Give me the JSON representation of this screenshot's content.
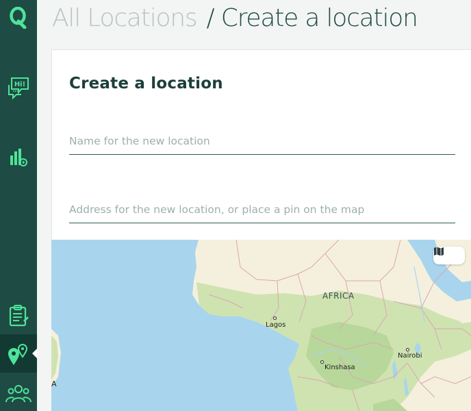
{
  "sidebar": {
    "logo_icon": "q-logo-icon",
    "items": [
      {
        "icon": "chat-hi-icon"
      },
      {
        "icon": "analytics-icon"
      },
      {
        "icon": "clipboard-icon"
      },
      {
        "icon": "location-pins-icon",
        "active": true
      },
      {
        "icon": "users-icon"
      }
    ],
    "accent": "#4fe39a"
  },
  "header": {
    "root": "All Locations",
    "separator": "/",
    "current": "Create a location"
  },
  "form": {
    "title": "Create a location",
    "name_placeholder": "Name for the new location",
    "address_placeholder": "Address for the new location, or place a pin on the map"
  },
  "map": {
    "region_label": "AFRICA",
    "cities": [
      "Lagos",
      "Kinshasa",
      "Nairobi"
    ],
    "partial_label": "A",
    "view_toggle_icon": "map-icon"
  }
}
